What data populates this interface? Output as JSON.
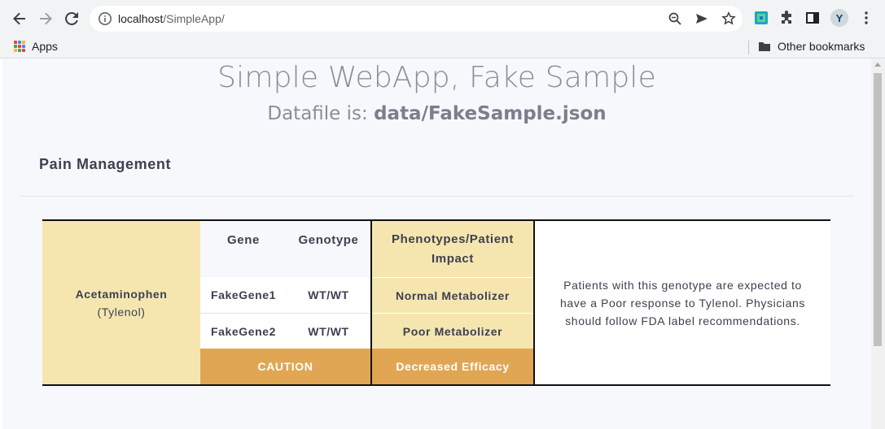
{
  "browser": {
    "url_host": "localhost",
    "url_path": "/SimpleApp/",
    "bookmarks": {
      "apps_label": "Apps",
      "other_label": "Other bookmarks"
    },
    "profile_initial": "Y"
  },
  "page": {
    "title": "Simple WebApp, Fake Sample",
    "subtitle_prefix": "Datafile is: ",
    "subtitle_file": "data/FakeSample.json",
    "section": "Pain Management"
  },
  "drug": {
    "name": "Acetaminophen",
    "brand": "(Tylenol)",
    "headers": {
      "gene": "Gene",
      "genotype": "Genotype",
      "phenotype": "Phenotypes/Patient Impact"
    },
    "rows": [
      {
        "gene": "FakeGene1",
        "genotype": "WT/WT",
        "phenotype": "Normal Metabolizer"
      },
      {
        "gene": "FakeGene2",
        "genotype": "WT/WT",
        "phenotype": "Poor Metabolizer"
      }
    ],
    "summary": {
      "label": "CAUTION",
      "phenotype": "Decreased Efficacy"
    },
    "impact": "Patients with this genotype are expected to have a Poor response to Tylenol. Physicians should follow FDA label recommendations.",
    "colors": {
      "drug_bg": "#f5e6b0",
      "caution_bg": "#e0a654"
    }
  }
}
